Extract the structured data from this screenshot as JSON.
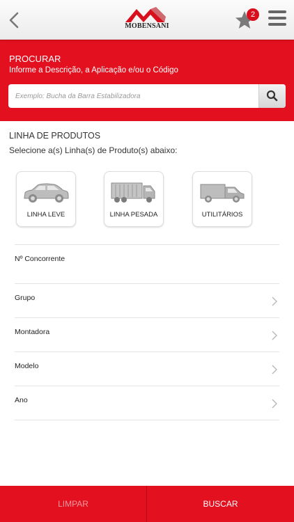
{
  "header": {
    "logo_text": "MOBENSANI",
    "favorites_count": "2"
  },
  "search": {
    "title": "PROCURAR",
    "subtitle": "Informe a Descrição, a Aplicação e/ou o Código",
    "placeholder": "Exemplo: Bucha da Barra Estabilizadora"
  },
  "product_lines": {
    "title": "LINHA DE PRODUTOS",
    "subtitle": "Selecione a(s) Linha(s) de Produto(s) abaixo:",
    "items": [
      {
        "label": "LINHA LEVE",
        "icon": "car-icon"
      },
      {
        "label": "LINHA PESADA",
        "icon": "truck-icon"
      },
      {
        "label": "UTILITÁRIOS",
        "icon": "van-icon"
      }
    ]
  },
  "filters": {
    "competitor_label": "Nº Concorrente",
    "group_label": "Grupo",
    "maker_label": "Montadora",
    "model_label": "Modelo",
    "year_label": "Ano"
  },
  "footer": {
    "clear_label": "LIMPAR",
    "search_label": "BUSCAR"
  },
  "colors": {
    "brand_red": "#e3101f",
    "badge_red": "#d8101e"
  }
}
